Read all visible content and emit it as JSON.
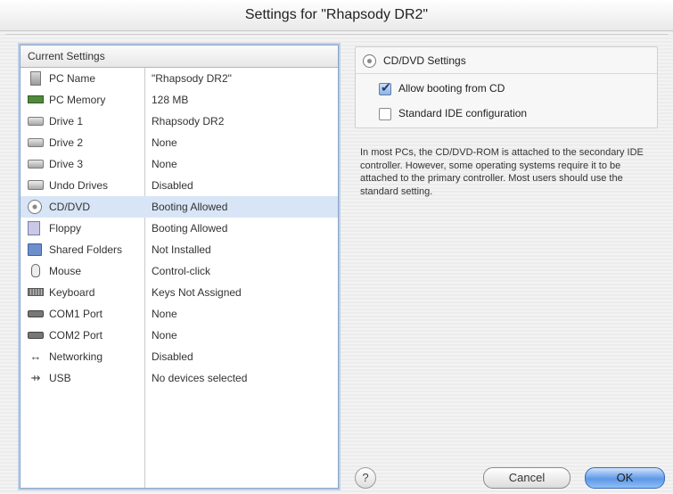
{
  "window": {
    "title": "Settings for \"Rhapsody DR2\""
  },
  "table": {
    "header": "Current Settings",
    "rows": [
      {
        "icon": "pc-icon",
        "name": "PC Name",
        "value": "\"Rhapsody DR2\""
      },
      {
        "icon": "memory-icon",
        "name": "PC Memory",
        "value": "128 MB"
      },
      {
        "icon": "drive-icon",
        "name": "Drive 1",
        "value": "Rhapsody DR2"
      },
      {
        "icon": "drive-icon",
        "name": "Drive 2",
        "value": "None"
      },
      {
        "icon": "drive-icon",
        "name": "Drive 3",
        "value": "None"
      },
      {
        "icon": "undo-drive-icon",
        "name": "Undo Drives",
        "value": "Disabled"
      },
      {
        "icon": "cd-icon",
        "name": "CD/DVD",
        "value": "Booting Allowed",
        "selected": true
      },
      {
        "icon": "floppy-icon",
        "name": "Floppy",
        "value": "Booting Allowed"
      },
      {
        "icon": "shared-folder-icon",
        "name": "Shared Folders",
        "value": "Not Installed"
      },
      {
        "icon": "mouse-icon",
        "name": "Mouse",
        "value": "Control-click"
      },
      {
        "icon": "keyboard-icon",
        "name": "Keyboard",
        "value": "Keys Not Assigned"
      },
      {
        "icon": "serial-port-icon",
        "name": "COM1 Port",
        "value": "None"
      },
      {
        "icon": "serial-port-icon",
        "name": "COM2 Port",
        "value": "None"
      },
      {
        "icon": "networking-icon",
        "name": "Networking",
        "value": "Disabled"
      },
      {
        "icon": "usb-icon",
        "name": "USB",
        "value": "No devices selected"
      }
    ]
  },
  "panel": {
    "title": "CD/DVD Settings",
    "options": [
      {
        "label": "Allow booting from CD",
        "checked": true
      },
      {
        "label": "Standard IDE configuration",
        "checked": false
      }
    ],
    "description": "In most PCs, the CD/DVD-ROM is attached to the secondary IDE controller. However, some operating systems require it to be attached to the primary controller. Most users should use the standard setting."
  },
  "buttons": {
    "help": "?",
    "cancel": "Cancel",
    "ok": "OK"
  },
  "colors": {
    "selection": "#d8e5f6",
    "ok_button": "#5e97e6",
    "table_border": "#8aa3c4"
  }
}
